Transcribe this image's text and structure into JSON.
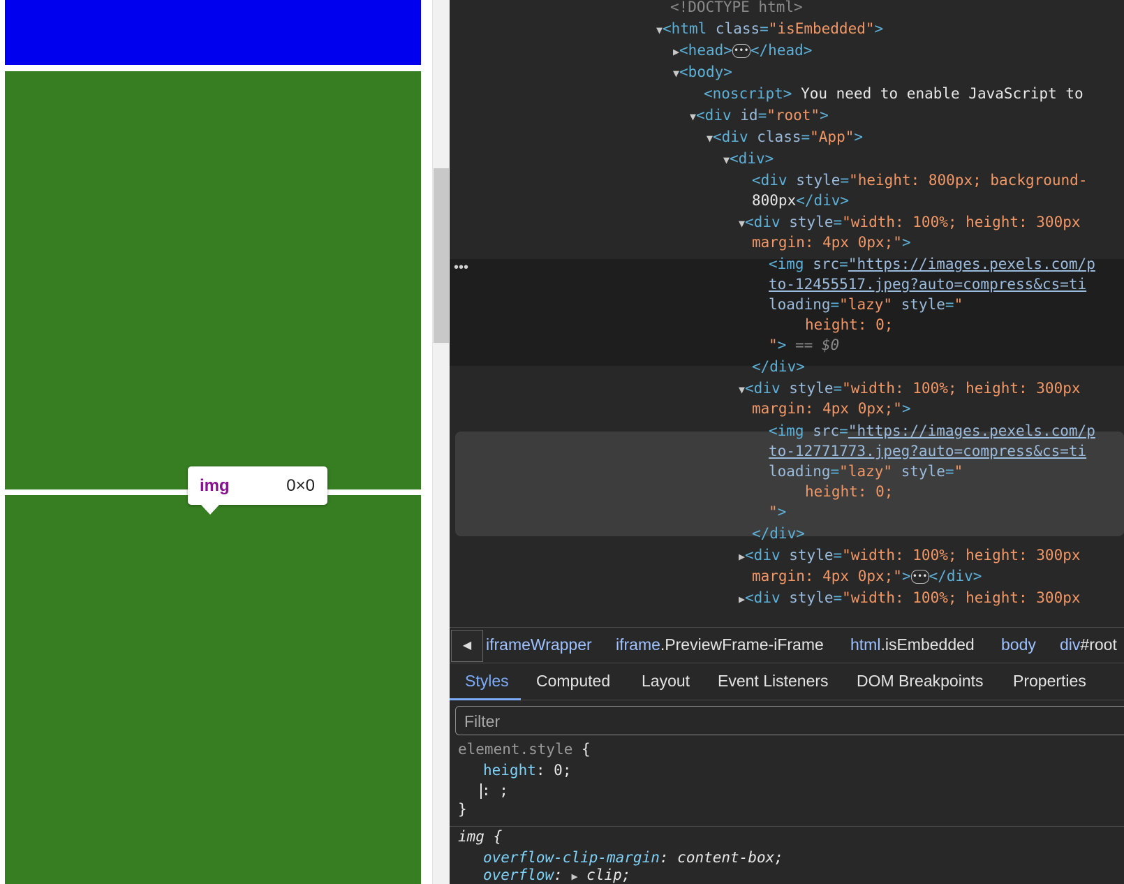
{
  "tooltip": {
    "tag": "img",
    "dimensions": "0×0"
  },
  "dom": {
    "doctype": "<!DOCTYPE html>",
    "html_tag": "<html",
    "html_attr": "class",
    "html_val": "\"isEmbedded\"",
    "head_open": "<head>",
    "head_close": "</head>",
    "body_open": "<body>",
    "noscript_open": "<noscript>",
    "noscript_text": " You need to enable JavaScript to",
    "div_root_tag": "<div",
    "id_attr": "id",
    "root_val": "\"root\"",
    "class_attr": "class",
    "app_val": "\"App\"",
    "div_open": "<div>",
    "div_tag": "<div",
    "style_attr": "style",
    "style_800": "\"height: 800px; background-",
    "text_800": "800px",
    "div_close": "</div>",
    "style_300": "\"width: 100%; height: 300px",
    "margin_cont": "margin: 4px 0px;\"",
    "img_tag": "<img",
    "src_attr": "src",
    "img1_src_a": "\"https://images.pexels.com/p",
    "img1_src_b": "to-12455517.jpeg?auto=compress&cs=ti",
    "img2_src_a": "\"https://images.pexels.com/p",
    "img2_src_b": "to-12771773.jpeg?auto=compress&cs=ti",
    "loading_attr": "loading",
    "lazy_val": "\"lazy\"",
    "style_open_val": "\"",
    "height_zero": "height: 0;",
    "style_close_val": "\"",
    "dollar0": "== $0"
  },
  "breadcrumb": [
    {
      "base": "iframeWrapper",
      "cls": ""
    },
    {
      "base": "iframe",
      "cls": ".PreviewFrame-iFrame"
    },
    {
      "base": "html",
      "cls": ".isEmbedded"
    },
    {
      "base": "body",
      "cls": ""
    },
    {
      "base": "div",
      "cls": "#root"
    }
  ],
  "tabs": [
    "Styles",
    "Computed",
    "Layout",
    "Event Listeners",
    "DOM Breakpoints",
    "Properties"
  ],
  "filter": {
    "placeholder": "Filter",
    "value": ""
  },
  "styles": {
    "element_selector": "element.style",
    "open_brace": "{",
    "close_brace": "}",
    "prop_height": "height",
    "val_height": "0",
    "img_selector": "img",
    "prop_ocm": "overflow-clip-margin",
    "val_ocm": "content-box",
    "prop_overflow": "overflow",
    "val_overflow": "clip"
  },
  "colors": {
    "blue_block": "#0000ee",
    "green_block": "#377e22",
    "devtools_bg": "#282828"
  }
}
